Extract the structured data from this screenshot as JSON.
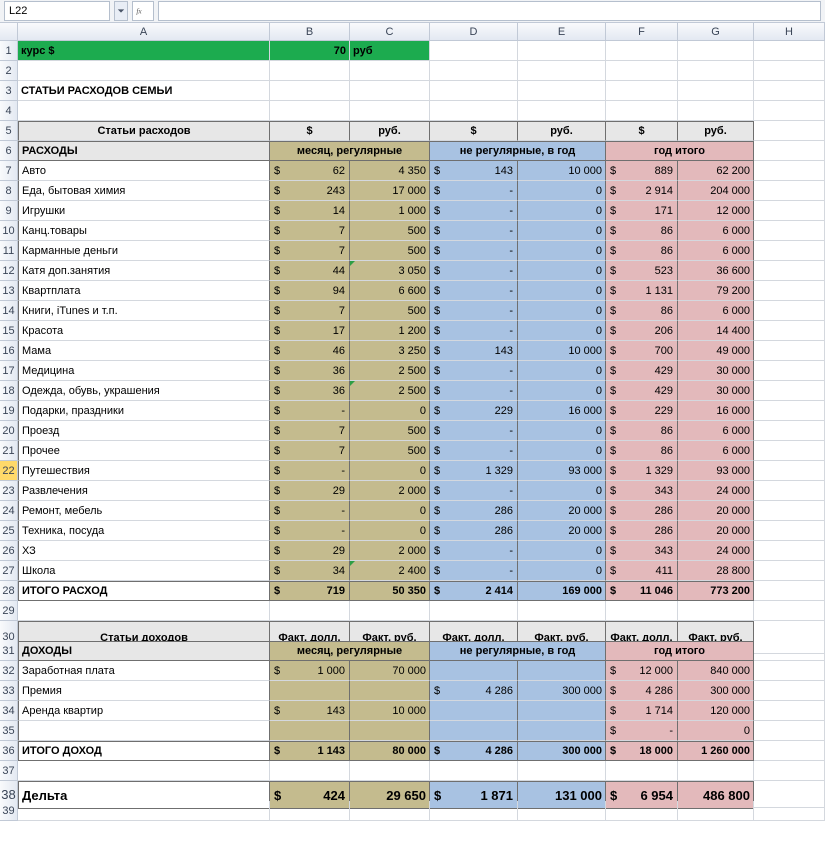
{
  "formula_bar": {
    "namebox": "L22",
    "fx": ""
  },
  "columns": [
    "",
    "A",
    "B",
    "C",
    "D",
    "E",
    "F",
    "G",
    "H"
  ],
  "row1": {
    "label": "курс $",
    "rate": "70",
    "unit": "руб"
  },
  "row3_title": "СТАТЬИ РАСХОДОВ СЕМЬИ",
  "hdr_expenses": {
    "cat": "Статьи расходов",
    "usd": "$",
    "rub": "руб."
  },
  "group_labels": {
    "exp": "РАСХОДЫ",
    "monthly": "месяц, регулярные",
    "irregular": "не регулярные, в год",
    "year": "год итого"
  },
  "expenses": [
    {
      "name": "Авто",
      "m_usd": "62",
      "m_rub": "4 350",
      "i_usd": "143",
      "i_rub": "10 000",
      "y_usd": "889",
      "y_rub": "62 200"
    },
    {
      "name": "Еда, бытовая химия",
      "m_usd": "243",
      "m_rub": "17 000",
      "i_usd": "-",
      "i_rub": "0",
      "y_usd": "2 914",
      "y_rub": "204 000"
    },
    {
      "name": "Игрушки",
      "m_usd": "14",
      "m_rub": "1 000",
      "i_usd": "-",
      "i_rub": "0",
      "y_usd": "171",
      "y_rub": "12 000"
    },
    {
      "name": "Канц.товары",
      "m_usd": "7",
      "m_rub": "500",
      "i_usd": "-",
      "i_rub": "0",
      "y_usd": "86",
      "y_rub": "6 000"
    },
    {
      "name": "Карманные деньги",
      "m_usd": "7",
      "m_rub": "500",
      "i_usd": "-",
      "i_rub": "0",
      "y_usd": "86",
      "y_rub": "6 000"
    },
    {
      "name": "Катя доп.занятия",
      "m_usd": "44",
      "m_rub": "3 050",
      "i_usd": "-",
      "i_rub": "0",
      "y_usd": "523",
      "y_rub": "36 600",
      "tri": true
    },
    {
      "name": "Квартплата",
      "m_usd": "94",
      "m_rub": "6 600",
      "i_usd": "-",
      "i_rub": "0",
      "y_usd": "1 131",
      "y_rub": "79 200"
    },
    {
      "name": "Книги, iTunes и т.п.",
      "m_usd": "7",
      "m_rub": "500",
      "i_usd": "-",
      "i_rub": "0",
      "y_usd": "86",
      "y_rub": "6 000"
    },
    {
      "name": "Красота",
      "m_usd": "17",
      "m_rub": "1 200",
      "i_usd": "-",
      "i_rub": "0",
      "y_usd": "206",
      "y_rub": "14 400"
    },
    {
      "name": "Мама",
      "m_usd": "46",
      "m_rub": "3 250",
      "i_usd": "143",
      "i_rub": "10 000",
      "y_usd": "700",
      "y_rub": "49 000"
    },
    {
      "name": "Медицина",
      "m_usd": "36",
      "m_rub": "2 500",
      "i_usd": "-",
      "i_rub": "0",
      "y_usd": "429",
      "y_rub": "30 000"
    },
    {
      "name": "Одежда, обувь, украшения",
      "m_usd": "36",
      "m_rub": "2 500",
      "i_usd": "-",
      "i_rub": "0",
      "y_usd": "429",
      "y_rub": "30 000",
      "tri": true
    },
    {
      "name": "Подарки, праздники",
      "m_usd": "-",
      "m_rub": "0",
      "i_usd": "229",
      "i_rub": "16 000",
      "y_usd": "229",
      "y_rub": "16 000"
    },
    {
      "name": "Проезд",
      "m_usd": "7",
      "m_rub": "500",
      "i_usd": "-",
      "i_rub": "0",
      "y_usd": "86",
      "y_rub": "6 000"
    },
    {
      "name": "Прочее",
      "m_usd": "7",
      "m_rub": "500",
      "i_usd": "-",
      "i_rub": "0",
      "y_usd": "86",
      "y_rub": "6 000"
    },
    {
      "name": "Путешествия",
      "m_usd": "-",
      "m_rub": "0",
      "i_usd": "1 329",
      "i_rub": "93 000",
      "y_usd": "1 329",
      "y_rub": "93 000"
    },
    {
      "name": "Развлечения",
      "m_usd": "29",
      "m_rub": "2 000",
      "i_usd": "-",
      "i_rub": "0",
      "y_usd": "343",
      "y_rub": "24 000"
    },
    {
      "name": "Ремонт, мебель",
      "m_usd": "-",
      "m_rub": "0",
      "i_usd": "286",
      "i_rub": "20 000",
      "y_usd": "286",
      "y_rub": "20 000"
    },
    {
      "name": "Техника, посуда",
      "m_usd": "-",
      "m_rub": "0",
      "i_usd": "286",
      "i_rub": "20 000",
      "y_usd": "286",
      "y_rub": "20 000"
    },
    {
      "name": "ХЗ",
      "m_usd": "29",
      "m_rub": "2 000",
      "i_usd": "-",
      "i_rub": "0",
      "y_usd": "343",
      "y_rub": "24 000"
    },
    {
      "name": "Школа",
      "m_usd": "34",
      "m_rub": "2 400",
      "i_usd": "-",
      "i_rub": "0",
      "y_usd": "411",
      "y_rub": "28 800",
      "tri": true
    }
  ],
  "expense_total": {
    "name": "ИТОГО РАСХОД",
    "m_usd": "719",
    "m_rub": "50 350",
    "i_usd": "2 414",
    "i_rub": "169 000",
    "y_usd": "11 046",
    "y_rub": "773 200"
  },
  "hdr_income": {
    "cat": "Статьи доходов",
    "col": "Факт, долл.",
    "rub": "Факт, руб.",
    "col_f": "Факт, долл.",
    "rub_f": "Факт, руб."
  },
  "group_labels_income": {
    "inc": "ДОХОДЫ"
  },
  "incomes": [
    {
      "name": "Заработная плата",
      "m_usd": "1 000",
      "m_rub": "70 000",
      "i_usd": "",
      "i_rub": "",
      "y_usd": "12 000",
      "y_rub": "840 000"
    },
    {
      "name": "Премия",
      "m_usd": "",
      "m_rub": "",
      "i_usd": "4 286",
      "i_rub": "300 000",
      "y_usd": "4 286",
      "y_rub": "300 000"
    },
    {
      "name": "Аренда квартир",
      "m_usd": "143",
      "m_rub": "10 000",
      "i_usd": "",
      "i_rub": "",
      "y_usd": "1 714",
      "y_rub": "120 000"
    },
    {
      "name": "",
      "m_usd": "",
      "m_rub": "",
      "i_usd": "",
      "i_rub": "",
      "y_usd": "-",
      "y_rub": "0"
    }
  ],
  "income_total": {
    "name": "ИТОГО ДОХОД",
    "m_usd": "1 143",
    "m_rub": "80 000",
    "i_usd": "4 286",
    "i_rub": "300 000",
    "y_usd": "18 000",
    "y_rub": "1 260 000"
  },
  "delta": {
    "name": "Дельта",
    "m_usd": "424",
    "m_rub": "29 650",
    "i_usd": "1 871",
    "i_rub": "131 000",
    "y_usd": "6 954",
    "y_rub": "486 800"
  }
}
